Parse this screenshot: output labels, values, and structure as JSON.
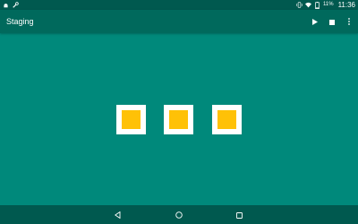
{
  "status_bar": {
    "time": "11:36",
    "battery_percent": "11%",
    "left_icons": [
      "android-debug-icon",
      "wrench-icon"
    ],
    "right_icons": [
      "vibrate-icon",
      "wifi-icon",
      "battery-icon"
    ]
  },
  "app_bar": {
    "title": "Staging",
    "actions": [
      "play-icon",
      "stop-icon",
      "overflow-menu-icon"
    ]
  },
  "tiles": [
    {
      "name": "tile-1",
      "fill": "#ffc107"
    },
    {
      "name": "tile-2",
      "fill": "#ffc107"
    },
    {
      "name": "tile-3",
      "fill": "#ffc107"
    }
  ],
  "nav_bar": {
    "buttons": [
      "back-icon",
      "home-icon",
      "recents-icon"
    ]
  },
  "colors": {
    "background": "#00897b",
    "app_bar": "#00695c",
    "status_bar": "#00594f",
    "tile_border": "#ffffff",
    "tile_fill": "#ffc107"
  }
}
